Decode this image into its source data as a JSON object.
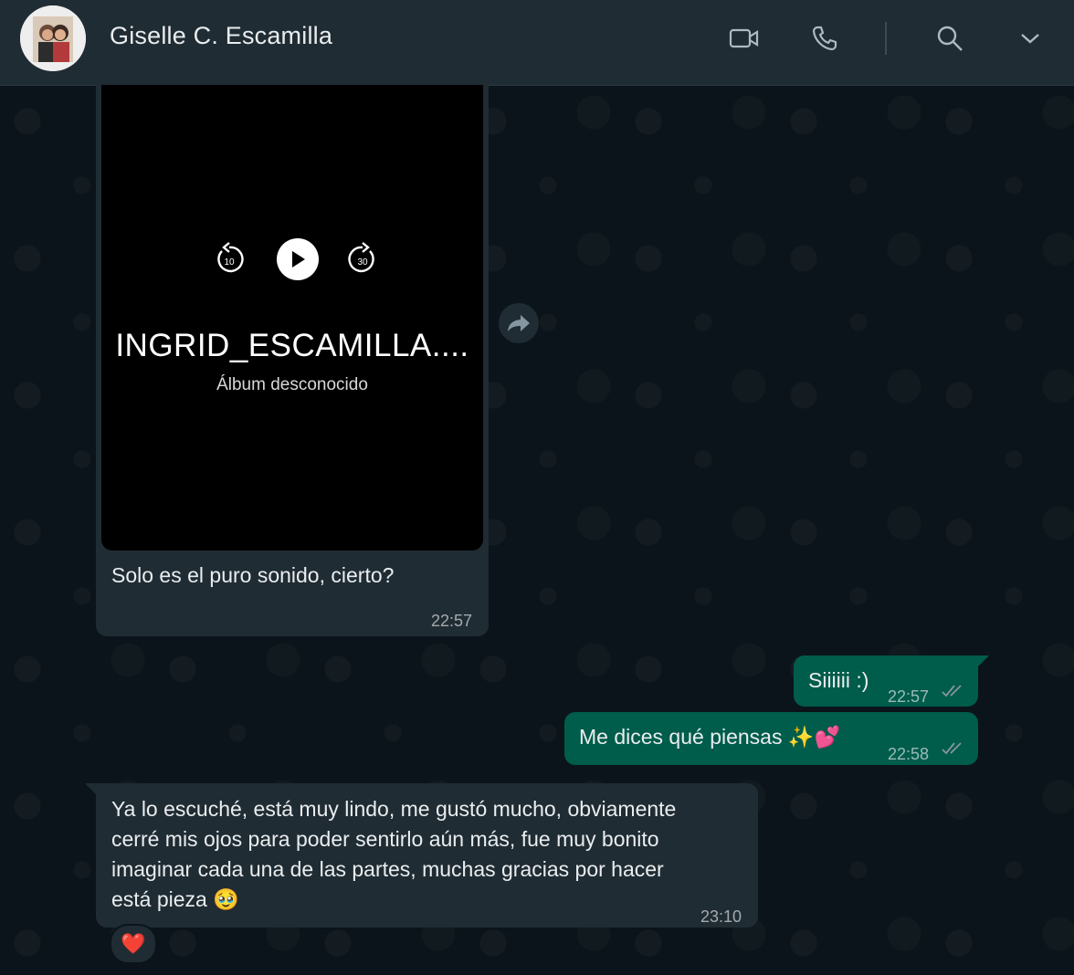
{
  "header": {
    "contact_name": "Giselle C. Escamilla",
    "icons": [
      "video-call-icon",
      "voice-call-icon",
      "search-icon",
      "chevron-down-icon"
    ]
  },
  "messages": [
    {
      "direction": "incoming",
      "type": "audio-media",
      "media_title": "INGRID_ESCAMILLA....",
      "media_subtitle": "Álbum desconocido",
      "skip_back": "10",
      "skip_forward": "30",
      "caption": "Solo es el puro sonido, cierto?",
      "time": "22:57"
    },
    {
      "direction": "outgoing",
      "text": "Siiiiii :)",
      "time": "22:57",
      "status": "read"
    },
    {
      "direction": "outgoing",
      "text": "Me dices qué piensas ✨💕",
      "time": "22:58",
      "status": "read"
    },
    {
      "direction": "incoming",
      "lines": [
        "Ya lo escuché, está muy lindo, me gustó mucho, obviamente",
        "cerré mis ojos para poder sentirlo aún más, fue muy bonito",
        "imaginar cada una de las partes, muchas gracias por hacer",
        "está pieza 🥹"
      ],
      "time": "23:10",
      "reaction": "❤️"
    }
  ],
  "colors": {
    "header_bg": "#202c33",
    "chat_bg": "#0b141a",
    "incoming_bubble": "#202c33",
    "outgoing_bubble": "#005c4b",
    "read_ticks": "#8696a0"
  }
}
